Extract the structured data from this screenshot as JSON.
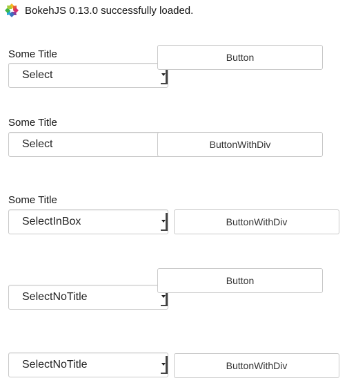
{
  "banner": {
    "text": "BokehJS 0.13.0 successfully loaded.",
    "logo_icon": "bokeh-logo-icon"
  },
  "rows": [
    {
      "title": "Some Title",
      "select_value": "Select",
      "button_label": "Button"
    },
    {
      "title": "Some Title",
      "select_value": "Select",
      "button_label": "ButtonWithDiv"
    },
    {
      "title": "Some Title",
      "select_value": "SelectInBox",
      "button_label": "ButtonWithDiv"
    },
    {
      "title": "",
      "select_value": "SelectNoTitle",
      "button_label": "Button"
    },
    {
      "title": "",
      "select_value": "SelectNoTitle",
      "button_label": "ButtonWithDiv"
    }
  ],
  "colors": {
    "border": "#c8c8c8",
    "text": "#222222",
    "background": "#ffffff"
  }
}
